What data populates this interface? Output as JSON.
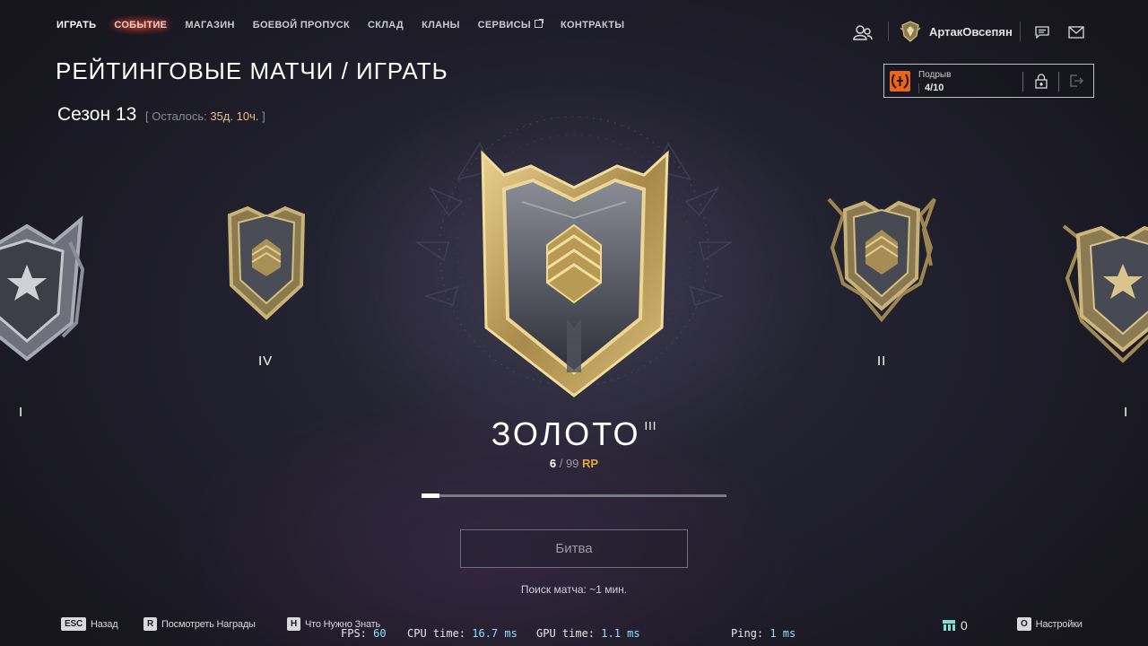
{
  "nav": {
    "items": [
      {
        "label": "ИГРАТЬ",
        "state": "active"
      },
      {
        "label": "СОБЫТИЕ",
        "state": "event"
      },
      {
        "label": "МАГАЗИН",
        "state": ""
      },
      {
        "label": "БОЕВОЙ ПРОПУСК",
        "state": ""
      },
      {
        "label": "СКЛАД",
        "state": ""
      },
      {
        "label": "КЛАНЫ",
        "state": ""
      },
      {
        "label": "СЕРВИСЫ",
        "state": "external"
      },
      {
        "label": "КОНТРАКТЫ",
        "state": ""
      }
    ]
  },
  "header": {
    "title": "РЕЙТИНГОВЫЕ МАТЧИ / ИГРАТЬ",
    "season": "Сезон 13",
    "remaining_prefix": "[ Осталось: ",
    "remaining_value": "35д. 10ч.",
    "remaining_suffix": " ]"
  },
  "player": {
    "name": "АртакОвсепян"
  },
  "challenge": {
    "name": "Подрыв",
    "progress": "4/10"
  },
  "ranks": {
    "left_far_label": "I",
    "left_label": "IV",
    "current_name": "ЗОЛОТО",
    "current_tier": "III",
    "right_label": "II",
    "right_far_label": "I",
    "rp_current": "6",
    "rp_sep": " / ",
    "rp_max": "99",
    "rp_unit": "RP",
    "rp_progress": 0.06
  },
  "battle": {
    "label": "Битва",
    "search": "Поиск матча: ~1 мин."
  },
  "hints": [
    {
      "key": "ESC",
      "label": "Назад"
    },
    {
      "key": "R",
      "label": "Посмотреть Награды"
    },
    {
      "key": "H",
      "label": "Что Нужно Знать"
    },
    {
      "key": "O",
      "label": "Настройки"
    }
  ],
  "stats": {
    "fps_label": "FPS: ",
    "fps": "60",
    "cpu_label": "CPU time: ",
    "cpu": "16.7 ms",
    "gpu_label": "GPU time: ",
    "gpu": "1.1 ms",
    "ping_label": "Ping: ",
    "ping": "1 ms"
  },
  "currency": {
    "value": "0"
  },
  "colors": {
    "gold": "#c9a45a",
    "accent_rp": "#e8a63c",
    "silver": "#8d8f99",
    "challenge_icon": "#e8661c"
  }
}
